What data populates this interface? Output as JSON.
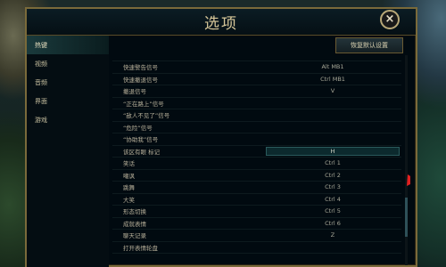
{
  "window": {
    "title": "选项",
    "close_symbol": "×"
  },
  "sidebar": {
    "items": [
      {
        "label": "热键",
        "active": true
      },
      {
        "label": "视频",
        "active": false
      },
      {
        "label": "音频",
        "active": false
      },
      {
        "label": "界面",
        "active": false
      },
      {
        "label": "游戏",
        "active": false
      }
    ]
  },
  "toolbar": {
    "reset_label": "恢复默认设置"
  },
  "keybinds": {
    "rows": [
      {
        "label": "快速警告信号",
        "key": "Alt MB1"
      },
      {
        "label": "快速撤退信号",
        "key": "Ctrl MB1"
      },
      {
        "label": "撤退信号",
        "key": "V"
      },
      {
        "label": "“正在路上”信号",
        "key": ""
      },
      {
        "label": "“敌人不见了”信号",
        "key": ""
      },
      {
        "label": "“危险”信号",
        "key": ""
      },
      {
        "label": "“协助我”信号",
        "key": ""
      },
      {
        "label": "该区有眼 标记",
        "key": "H"
      },
      {
        "label": "笑话",
        "key": "Ctrl 1"
      },
      {
        "label": "嘲讽",
        "key": "Ctrl 2"
      },
      {
        "label": "跳舞",
        "key": "Ctrl 3"
      },
      {
        "label": "大笑",
        "key": "Ctrl 4"
      },
      {
        "label": "形态切换",
        "key": "Ctrl 5"
      },
      {
        "label": "成就表情",
        "key": "Ctrl 6"
      },
      {
        "label": "聊天记录",
        "key": "Z"
      },
      {
        "label": "打开表情轮盘",
        "key": ""
      }
    ],
    "selected_row": "该区有眼 标记"
  },
  "colors": {
    "accent_gold": "#c8aa6e",
    "panel_bg": "#010a10",
    "annotation_red": "#e02020"
  },
  "icons": {
    "close": "close-icon",
    "annotation": "red-arrow-icon",
    "pointer": "mouse-cursor-icon"
  }
}
